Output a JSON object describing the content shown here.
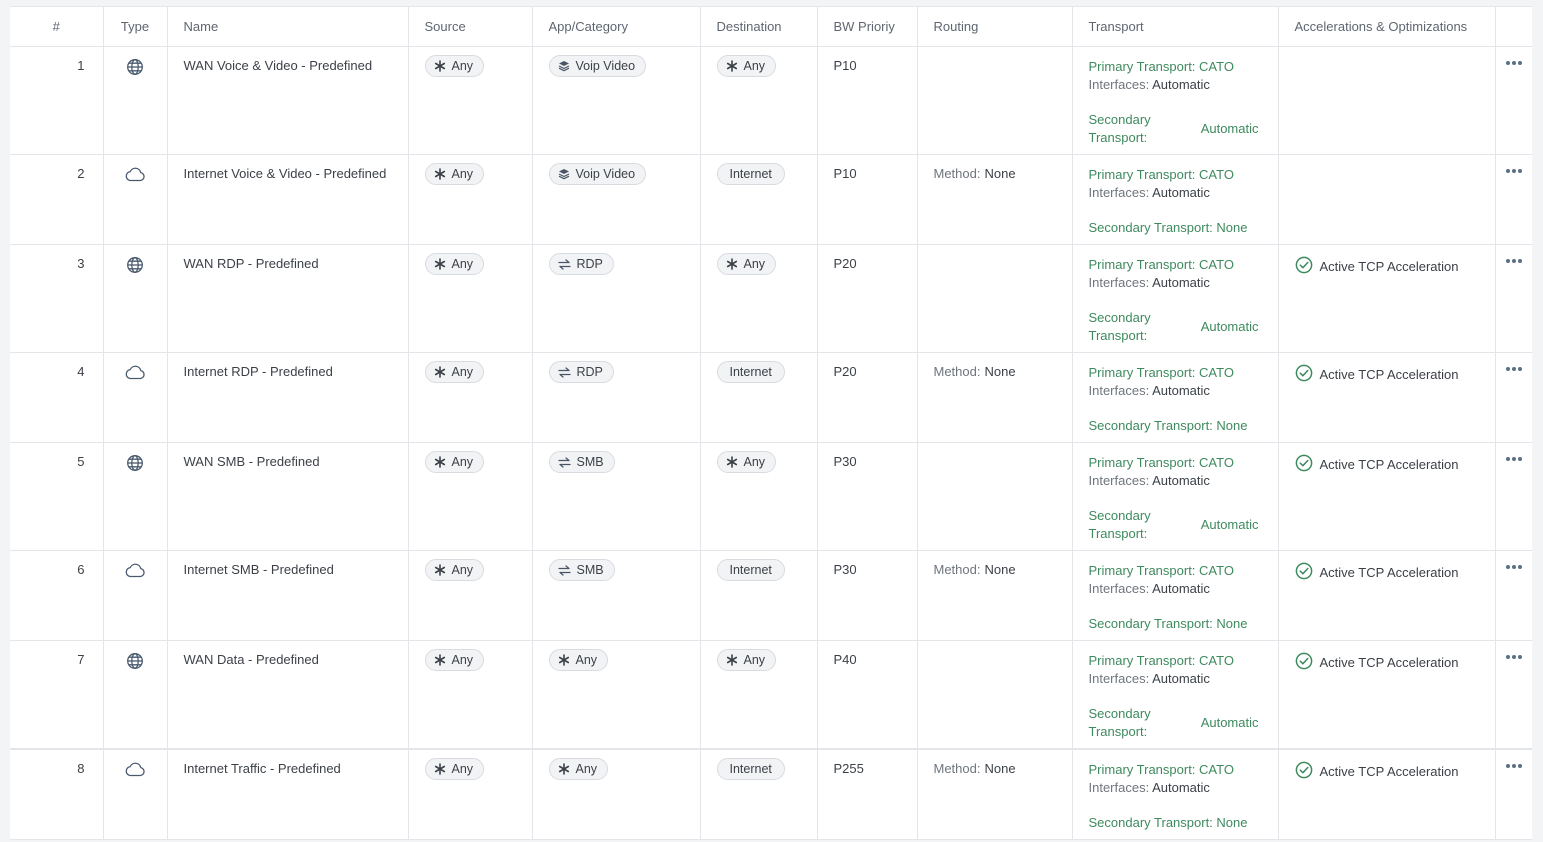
{
  "columns": {
    "num": "#",
    "type": "Type",
    "name": "Name",
    "source": "Source",
    "app": "App/Category",
    "destination": "Destination",
    "bw": "BW Prioriy",
    "routing": "Routing",
    "transport": "Transport",
    "accel": "Accelerations & Optimizations"
  },
  "colors": {
    "green": "#3e8a5e",
    "border": "#e3e5e8",
    "pill_bg": "#f2f3f5"
  },
  "rows": [
    {
      "num": "1",
      "type": "globe-icon",
      "name": "WAN Voice & Video - Predefined",
      "source": "Any",
      "app": "Voip Video",
      "app_icon": "layers-icon",
      "destination": "Any",
      "dest_icon": "asterisk-icon",
      "bw": "P10",
      "routing_label": "",
      "routing_value": "",
      "primary_label": "Primary Transport:",
      "primary_value": "CATO",
      "interfaces_label": "Interfaces:",
      "interfaces_value": "Automatic",
      "secondary_label": "Secondary Transport:",
      "secondary_value": "Automatic",
      "secondary_layout": "wrap",
      "accel": ""
    },
    {
      "num": "2",
      "type": "cloud-icon",
      "name": "Internet Voice & Video - Predefined",
      "source": "Any",
      "app": "Voip Video",
      "app_icon": "layers-icon",
      "destination": "Internet",
      "dest_icon": "",
      "bw": "P10",
      "routing_label": "Method:",
      "routing_value": "None",
      "primary_label": "Primary Transport:",
      "primary_value": "CATO",
      "interfaces_label": "Interfaces:",
      "interfaces_value": "Automatic",
      "secondary_label": "Secondary Transport:",
      "secondary_value": "None",
      "secondary_layout": "inline",
      "accel": ""
    },
    {
      "num": "3",
      "type": "globe-icon",
      "name": "WAN RDP - Predefined",
      "source": "Any",
      "app": "RDP",
      "app_icon": "transfer-icon",
      "destination": "Any",
      "dest_icon": "asterisk-icon",
      "bw": "P20",
      "routing_label": "",
      "routing_value": "",
      "primary_label": "Primary Transport:",
      "primary_value": "CATO",
      "interfaces_label": "Interfaces:",
      "interfaces_value": "Automatic",
      "secondary_label": "Secondary Transport:",
      "secondary_value": "Automatic",
      "secondary_layout": "wrap",
      "accel": "Active TCP Acceleration"
    },
    {
      "num": "4",
      "type": "cloud-icon",
      "name": "Internet RDP - Predefined",
      "source": "Any",
      "app": "RDP",
      "app_icon": "transfer-icon",
      "destination": "Internet",
      "dest_icon": "",
      "bw": "P20",
      "routing_label": "Method:",
      "routing_value": "None",
      "primary_label": "Primary Transport:",
      "primary_value": "CATO",
      "interfaces_label": "Interfaces:",
      "interfaces_value": "Automatic",
      "secondary_label": "Secondary Transport:",
      "secondary_value": "None",
      "secondary_layout": "inline",
      "accel": "Active TCP Acceleration"
    },
    {
      "num": "5",
      "type": "globe-icon",
      "name": "WAN SMB - Predefined",
      "source": "Any",
      "app": "SMB",
      "app_icon": "transfer-icon",
      "destination": "Any",
      "dest_icon": "asterisk-icon",
      "bw": "P30",
      "routing_label": "",
      "routing_value": "",
      "primary_label": "Primary Transport:",
      "primary_value": "CATO",
      "interfaces_label": "Interfaces:",
      "interfaces_value": "Automatic",
      "secondary_label": "Secondary Transport:",
      "secondary_value": "Automatic",
      "secondary_layout": "wrap",
      "accel": "Active TCP Acceleration"
    },
    {
      "num": "6",
      "type": "cloud-icon",
      "name": "Internet SMB - Predefined",
      "source": "Any",
      "app": "SMB",
      "app_icon": "transfer-icon",
      "destination": "Internet",
      "dest_icon": "",
      "bw": "P30",
      "routing_label": "Method:",
      "routing_value": "None",
      "primary_label": "Primary Transport:",
      "primary_value": "CATO",
      "interfaces_label": "Interfaces:",
      "interfaces_value": "Automatic",
      "secondary_label": "Secondary Transport:",
      "secondary_value": "None",
      "secondary_layout": "inline",
      "accel": "Active TCP Acceleration"
    },
    {
      "num": "7",
      "type": "globe-icon",
      "name": "WAN Data - Predefined",
      "source": "Any",
      "app": "Any",
      "app_icon": "asterisk-icon",
      "destination": "Any",
      "dest_icon": "asterisk-icon",
      "bw": "P40",
      "routing_label": "",
      "routing_value": "",
      "primary_label": "Primary Transport:",
      "primary_value": "CATO",
      "interfaces_label": "Interfaces:",
      "interfaces_value": "Automatic",
      "secondary_label": "Secondary Transport:",
      "secondary_value": "Automatic",
      "secondary_layout": "wrap",
      "accel": "Active TCP Acceleration"
    },
    {
      "num": "8",
      "type": "cloud-icon",
      "name": "Internet Traffic - Predefined",
      "source": "Any",
      "app": "Any",
      "app_icon": "asterisk-icon",
      "destination": "Internet",
      "dest_icon": "",
      "bw": "P255",
      "routing_label": "Method:",
      "routing_value": "None",
      "primary_label": "Primary Transport:",
      "primary_value": "CATO",
      "interfaces_label": "Interfaces:",
      "interfaces_value": "Automatic",
      "secondary_label": "Secondary Transport:",
      "secondary_value": "None",
      "secondary_layout": "inline",
      "accel": "Active TCP Acceleration"
    }
  ]
}
